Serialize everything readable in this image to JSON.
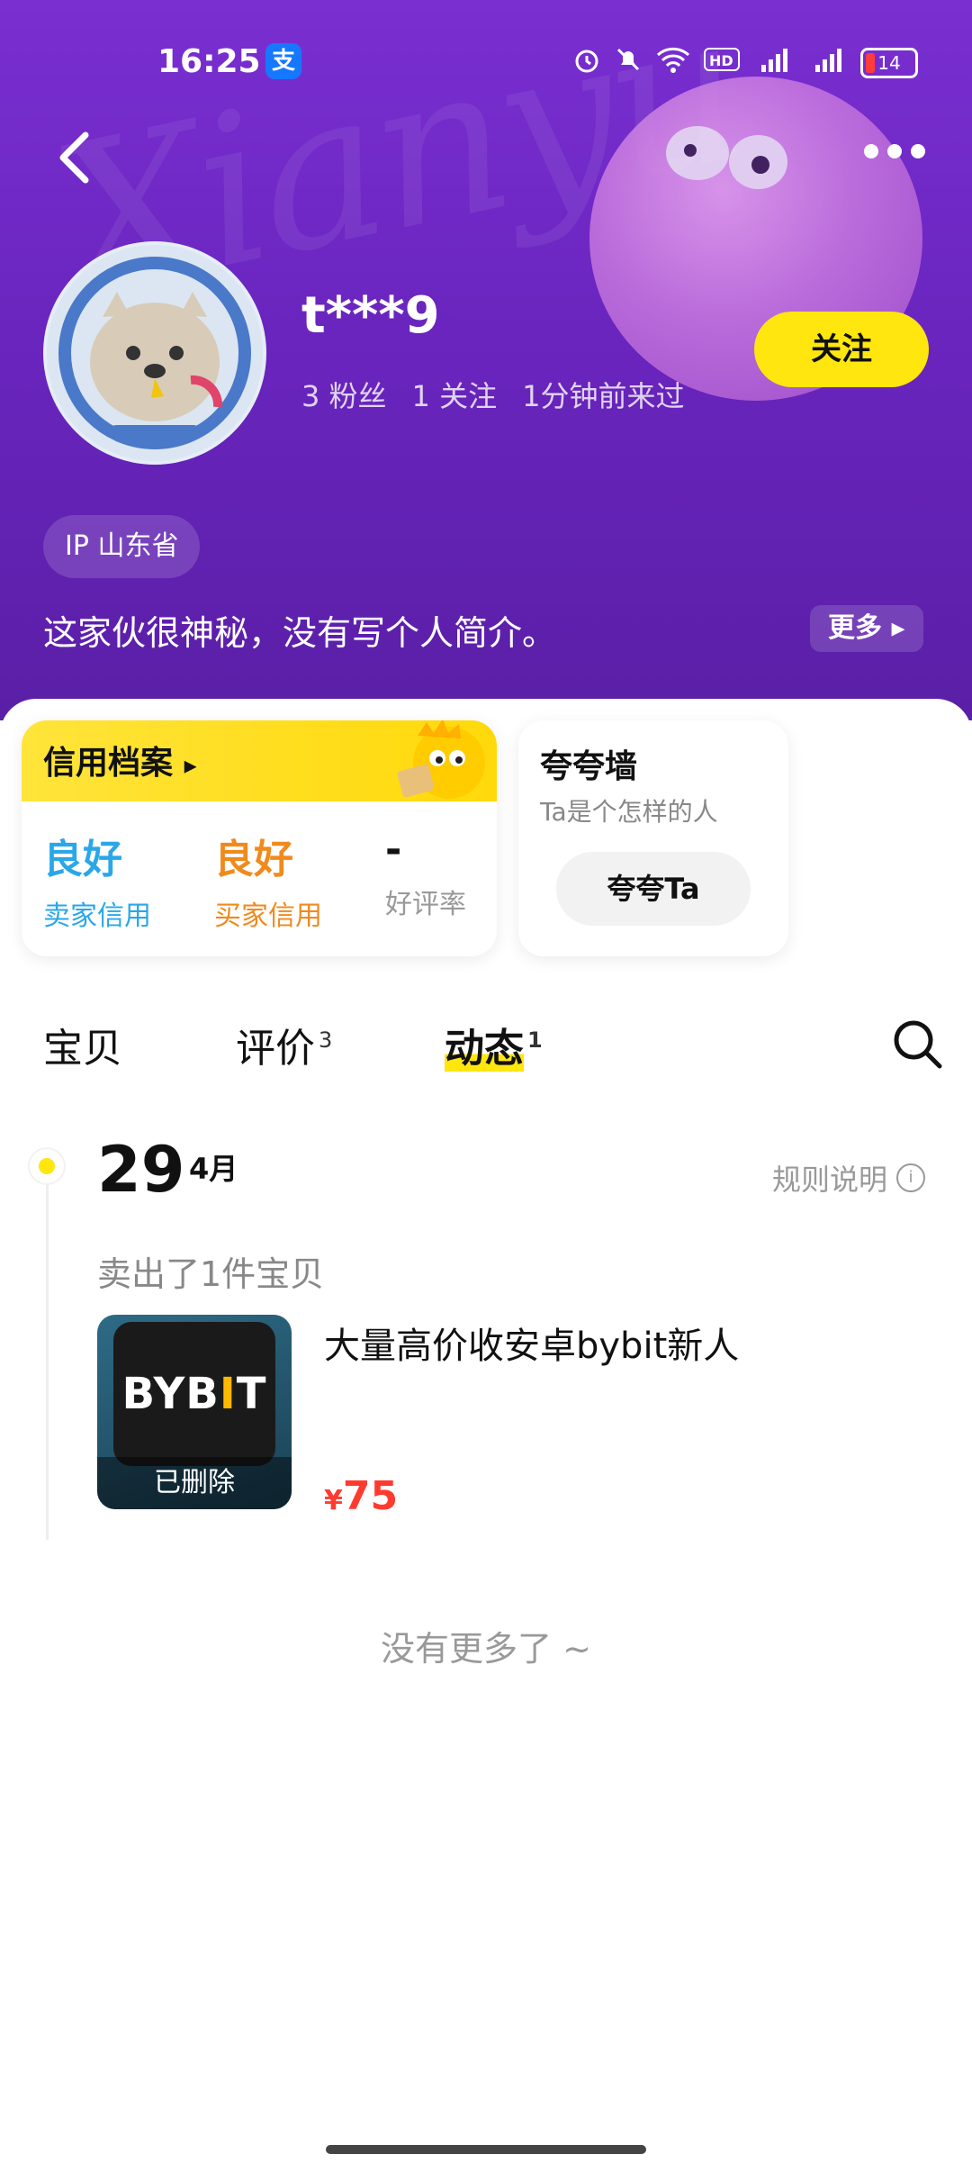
{
  "status_bar": {
    "time": "16:25",
    "alipay_icon_text": "支",
    "battery": "14"
  },
  "profile": {
    "nickname": "t***9",
    "fans": "3 粉丝",
    "following": "1 关注",
    "last_seen": "1分钟前来过",
    "follow_label": "关注",
    "ip": "IP 山东省",
    "bio": "这家伙很神秘，没有写个人简介。",
    "bio_more": "更多"
  },
  "credit": {
    "title": "信用档案",
    "seller_value": "良好",
    "seller_label": "卖家信用",
    "buyer_value": "良好",
    "buyer_label": "买家信用",
    "rate_value": "-",
    "rate_label": "好评率"
  },
  "kuakua": {
    "title": "夸夸墙",
    "subtitle": "Ta是个怎样的人",
    "button": "夸夸Ta"
  },
  "tabs": [
    {
      "label": "宝贝",
      "count": ""
    },
    {
      "label": "评价",
      "count": "3"
    },
    {
      "label": "动态",
      "count": "1"
    }
  ],
  "timeline": {
    "day": "29",
    "month": "4月",
    "rules_label": "规则说明",
    "event": "卖出了1件宝贝",
    "item": {
      "thumb_text_a": "BYB",
      "thumb_text_b": "I",
      "thumb_text_c": "T",
      "status": "已删除",
      "title": "大量高价收安卓bybit新人",
      "currency": "¥",
      "price": "75"
    }
  },
  "footer": {
    "no_more": "没有更多了 ~"
  },
  "colors": {
    "accent_yellow": "#ffe60f",
    "seller_blue": "#2aa7e8",
    "buyer_orange": "#f08a1c",
    "price_red": "#ff3b30",
    "header_purple": "#6a25bf"
  }
}
